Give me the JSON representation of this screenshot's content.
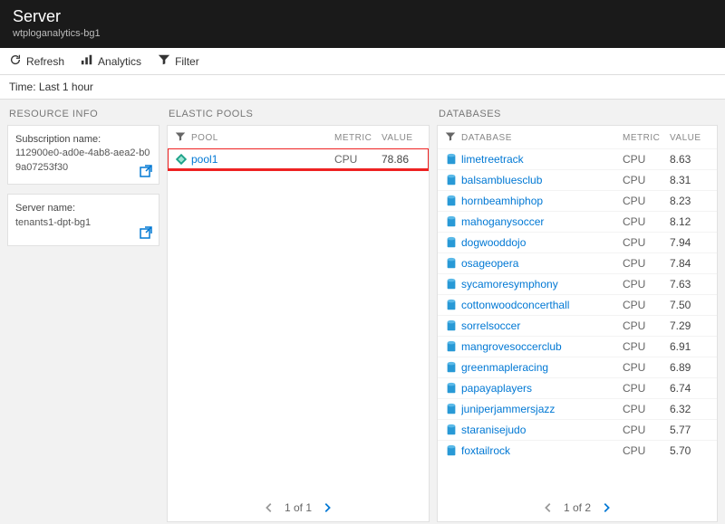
{
  "header": {
    "title": "Server",
    "subtitle": "wtploganalytics-bg1"
  },
  "toolbar": {
    "refresh": "Refresh",
    "analytics": "Analytics",
    "filter": "Filter"
  },
  "time": {
    "label": "Time: Last 1 hour"
  },
  "sidebar": {
    "title": "RESOURCE INFO",
    "subscription": {
      "label": "Subscription name:",
      "value": "112900e0-ad0e-4ab8-aea2-b09a07253f30"
    },
    "server": {
      "label": "Server name:",
      "value": "tenants1-dpt-bg1"
    }
  },
  "pools": {
    "title": "ELASTIC POOLS",
    "headers": {
      "name": "POOL",
      "metric": "METRIC",
      "value": "VALUE"
    },
    "rows": [
      {
        "name": "pool1",
        "metric": "CPU",
        "value": "78.86",
        "highlight": true
      }
    ],
    "pager": {
      "text": "1 of 1"
    }
  },
  "databases": {
    "title": "DATABASES",
    "headers": {
      "name": "DATABASE",
      "metric": "METRIC",
      "value": "VALUE"
    },
    "rows": [
      {
        "name": "limetreetrack",
        "metric": "CPU",
        "value": "8.63"
      },
      {
        "name": "balsambluesclub",
        "metric": "CPU",
        "value": "8.31"
      },
      {
        "name": "hornbeamhiphop",
        "metric": "CPU",
        "value": "8.23"
      },
      {
        "name": "mahoganysoccer",
        "metric": "CPU",
        "value": "8.12"
      },
      {
        "name": "dogwooddojo",
        "metric": "CPU",
        "value": "7.94"
      },
      {
        "name": "osageopera",
        "metric": "CPU",
        "value": "7.84"
      },
      {
        "name": "sycamoresymphony",
        "metric": "CPU",
        "value": "7.63"
      },
      {
        "name": "cottonwoodconcerthall",
        "metric": "CPU",
        "value": "7.50"
      },
      {
        "name": "sorrelsoccer",
        "metric": "CPU",
        "value": "7.29"
      },
      {
        "name": "mangrovesoccerclub",
        "metric": "CPU",
        "value": "6.91"
      },
      {
        "name": "greenmapleracing",
        "metric": "CPU",
        "value": "6.89"
      },
      {
        "name": "papayaplayers",
        "metric": "CPU",
        "value": "6.74"
      },
      {
        "name": "juniperjammersjazz",
        "metric": "CPU",
        "value": "6.32"
      },
      {
        "name": "staranisejudo",
        "metric": "CPU",
        "value": "5.77"
      },
      {
        "name": "foxtailrock",
        "metric": "CPU",
        "value": "5.70"
      }
    ],
    "pager": {
      "text": "1 of 2"
    }
  },
  "colors": {
    "accent": "#0078d4",
    "highlight": "#e22"
  }
}
